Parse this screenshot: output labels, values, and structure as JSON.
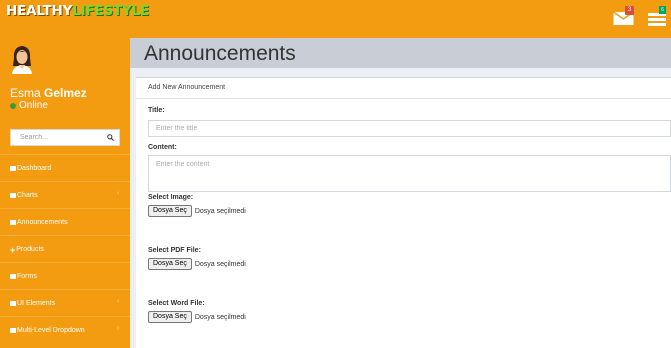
{
  "header": {
    "logo_part1": "HEALTHY",
    "logo_part2": "LIFESTYLE",
    "mail_icon": "envelope-icon",
    "mail_badge": "3",
    "tasks_icon": "tasks-icon",
    "tasks_badge": "6"
  },
  "sidebar": {
    "user_first": "Esma",
    "user_last": "Gelmez",
    "status": "Online",
    "search_placeholder": "Search...",
    "items": [
      {
        "label": "Dashboard",
        "icon": "dashboard-icon",
        "chevron": false
      },
      {
        "label": "Charts",
        "icon": "chart-icon",
        "chevron": true
      },
      {
        "label": "Announcements",
        "icon": "megaphone-icon",
        "chevron": false
      },
      {
        "label": "Products",
        "icon": "plus-icon",
        "chevron": false
      },
      {
        "label": "Forms",
        "icon": "edit-icon",
        "chevron": false
      },
      {
        "label": "UI Elements",
        "icon": "wrench-icon",
        "chevron": true
      },
      {
        "label": "Multi-Level Dropdown",
        "icon": "sitemap-icon",
        "chevron": true
      }
    ]
  },
  "page": {
    "title": "Announcements",
    "box_title": "Add New Announcement",
    "title_label": "Title:",
    "title_placeholder": "Enter the title",
    "content_label": "Content:",
    "content_placeholder": "Enter the content",
    "image_label": "Select Image:",
    "pdf_label": "Select PDF File:",
    "word_label": "Select Word File:",
    "file_button": "Dosya Seç",
    "no_file": "Dosya seçilmedi"
  },
  "colors": {
    "accent": "#f39c12",
    "header_bar": "#c9ced6",
    "background": "#ecf0f5"
  }
}
